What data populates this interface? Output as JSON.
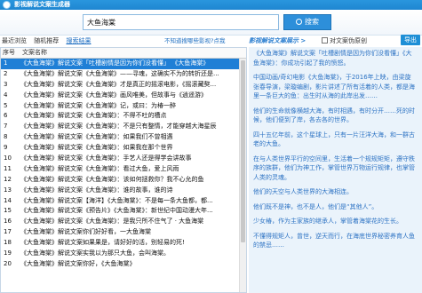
{
  "window": {
    "title": "影视解说文案生成器"
  },
  "search": {
    "value": "大鱼海棠",
    "button_label": "搜索"
  },
  "tabs": [
    "最近浏览",
    "随机推荐",
    "搜索结果"
  ],
  "hint": "不知道搜哪些影视?点我",
  "right_title": "影视解说文案展示 >",
  "copy_option": "对文案伪原创",
  "export_label": "导出",
  "list": {
    "headers": {
      "no": "序号",
      "name": "文案名称"
    },
    "rows": [
      {
        "no": "1",
        "name": "《大鱼海棠》解说文案「吐槽剧情是因为你们没看懂」 《大鱼海棠》"
      },
      {
        "no": "2",
        "name": "《大鱼海棠》解说文案《大鱼海棠》——寻魂，这确实不为的转折还是..."
      },
      {
        "no": "3",
        "name": "《大鱼海棠》解说文案《大鱼海棠》才是真正的摇滚电影，《摇滚藏獒..."
      },
      {
        "no": "4",
        "name": "《大鱼海棠》解说文案《大鱼海棠》画风唯美，但故事与《逍遥游》"
      },
      {
        "no": "5",
        "name": "《大鱼海棠》解说文案《大鱼海棠》记，或曰：为椿一醉"
      },
      {
        "no": "6",
        "name": "《大鱼海棠》解说文案《大鱼海棠》：不得不吐的槽点"
      },
      {
        "no": "7",
        "name": "《大鱼海棠》解说文案《大鱼海棠》：不是只有整情，才能穿越大海星辰"
      },
      {
        "no": "8",
        "name": "《大鱼海棠》解说文案《大鱼海棠》：如果我们不曾相遇"
      },
      {
        "no": "9",
        "name": "《大鱼海棠》解说文案《大鱼海棠》：如果我在那个世界"
      },
      {
        "no": "10",
        "name": "《大鱼海棠》解说文案《大鱼海棠》：手艺人还是得学会讲故事"
      },
      {
        "no": "11",
        "name": "《大鱼海棠》解说文案《大鱼海棠》：看过大鱼，爱上风雨"
      },
      {
        "no": "12",
        "name": "《大鱼海棠》解说文案《大鱼海棠》：该如何拯救你？我不心允的鱼"
      },
      {
        "no": "13",
        "name": "《大鱼海棠》解说文案《大鱼海棠》：谁的故事，谁的诗"
      },
      {
        "no": "14",
        "name": "《大鱼海棠》解说文案【海洋】《大鱼海棠》：不是每一条大鱼都，都..."
      },
      {
        "no": "15",
        "name": "《大鱼海棠》解说文案《预告片》《大鱼海棠》：新世纪中国动漫大年..."
      },
      {
        "no": "16",
        "name": "《大鱼海棠》解说文案《大鱼海棠》：是我只所不住气了 · 大鱼海棠"
      },
      {
        "no": "17",
        "name": "《大鱼海棠》解说文案你们好好看，一大鱼海棠"
      },
      {
        "no": "18",
        "name": "《大鱼海棠》解说文案如果果是，请好好的活，别轻易的死!"
      },
      {
        "no": "19",
        "name": "《大鱼海棠》解说文案实我以为那只大鱼，会叫海棠。"
      },
      {
        "no": "20",
        "name": "《大鱼海棠》解说文案你好，《大鱼海棠》"
      }
    ]
  },
  "content": {
    "paragraphs": [
      "《大鱼海棠》解说文案「吐槽剧情是因为你们没看懂」《大鱼海棠》：你成功引起了我的愤怒。",
      "中国动画/奇幻电影《大鱼海棠》，于2016年上映，由梁旋张春导演，梁璇编剧，影片讲述了所有活着的人类，都是海里一条巨大的鱼：出生时从海的此岸出发……",
      "他们的生命就像横越大海，有时相遇，有时分开……死的时候，他们便到了岸，各去各的世界。",
      "四十五亿年前，这个星球上，只有一片汪洋大海，和一群古老的大鱼。",
      "在与人类世界平行的空间里，生活着一个规规矩矩，遵守秩序的族群，他们为神工作，掌管世界万物运行规律，也掌管人类的灵魂。",
      "他们的天空与人类世界的大海相连。",
      "他们既不是神，也不是人，他们是“其他人”。",
      "少女椿，作为主家族的继承人，掌管着海棠花的生长。",
      "不懂得规矩人，曾世，逆天而行，在海底世界秘密养育人鱼的禁忌……"
    ]
  },
  "selected_row": 0
}
